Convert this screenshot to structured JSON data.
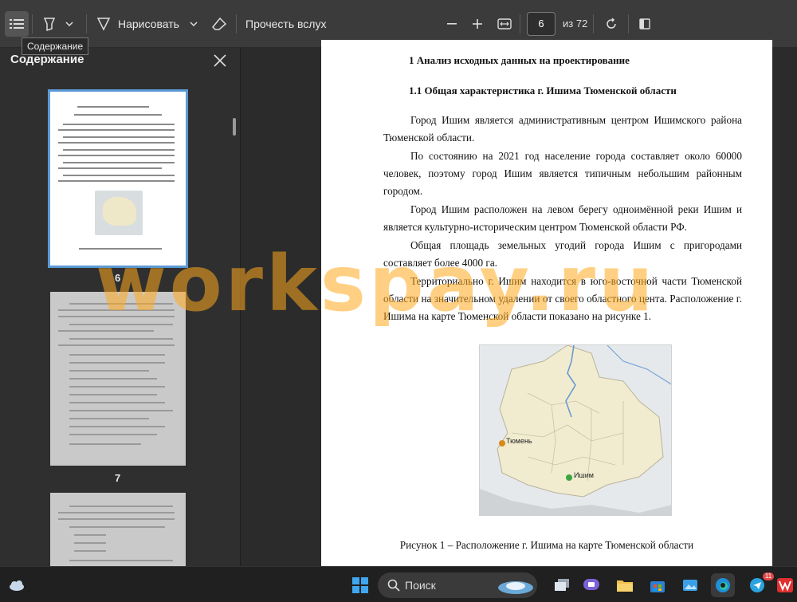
{
  "toolbar": {
    "draw_label": "Нарисовать",
    "read_aloud_label": "Прочесть вслух",
    "page_current": "6",
    "page_total": "из 72",
    "tooltip": "Содержание"
  },
  "sidebar": {
    "title": "Содержание",
    "thumbnails": [
      {
        "label": "6",
        "selected": true
      },
      {
        "label": "7",
        "selected": false
      }
    ]
  },
  "document": {
    "heading1": "1 Анализ исходных данных на проектирование",
    "heading2": "1.1 Общая характеристика г. Ишима Тюменской области",
    "paragraphs": [
      "Город Ишим является административным центром Ишимского района Тюменской области.",
      "По состоянию на 2021 год население города составляет около 60000 человек, поэтому город Ишим является типичным небольшим районным городом.",
      "Город Ишим расположен на левом берегу одноимённой реки Ишим и является культурно-историческим центром Тюменской области РФ.",
      "Общая площадь земельных угодий города Ишим с пригородами составляет более 4000 га.",
      "Территориально г. Ишим находится в юго-восточной части Тюменской области на значительном удалении от своего областного цента. Расположение г. Ишима на карте Тюменской области показано на рисунке 1."
    ],
    "map_labels": {
      "city1": "Тюмень",
      "city2": "Ишим"
    },
    "caption": "Рисунок 1 – Расположение г. Ишима на карте Тюменской области"
  },
  "watermark": "workspay.ru",
  "taskbar": {
    "search_label": "Поиск",
    "telegram_badge": "11"
  },
  "colors": {
    "accent": "#5b9bd5",
    "watermark": "#ffaa1e"
  }
}
